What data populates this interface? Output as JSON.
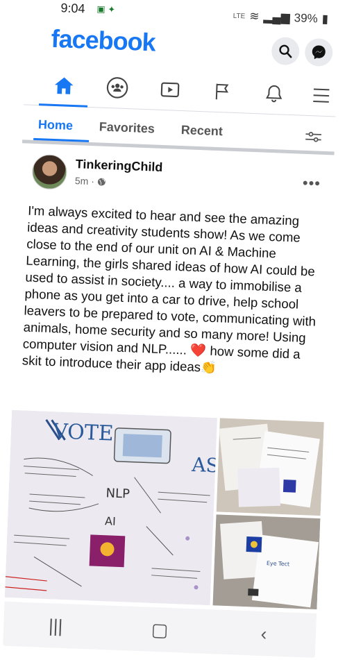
{
  "status_bar": {
    "time": "9:04",
    "network": "LTE",
    "battery": "39%"
  },
  "app": {
    "logo": "facebook"
  },
  "nav": {
    "active": "home-icon"
  },
  "tabs": [
    {
      "label": "Home",
      "active": true
    },
    {
      "label": "Favorites",
      "active": false
    },
    {
      "label": "Recent",
      "active": false
    }
  ],
  "post": {
    "author": "TinkeringChild",
    "time": "5m",
    "text": "I'm always excited to hear and see the amazing ideas and creativity students show! As we come close to the end of our unit on AI & Machine Learning, the girls shared ideas of how AI could be used to assist in society.... a way to immobilise a phone as you get into a car to drive, help school leavers to be prepared to vote, communicating with animals, home security and so many more! Using computer vision and NLP...... ❤️ how some did a skit to introduce their app ideas👏"
  },
  "colors": {
    "brand": "#1877f2",
    "text": "#111111",
    "muted": "#666666"
  }
}
